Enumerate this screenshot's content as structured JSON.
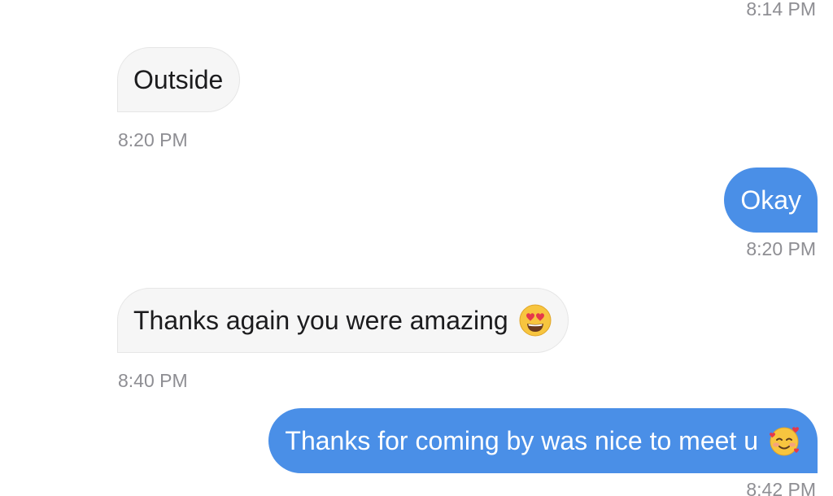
{
  "messages": [
    {
      "direction": "outgoing",
      "timestamp": "8:14 PM"
    },
    {
      "direction": "incoming",
      "text": "Outside",
      "timestamp": "8:20 PM"
    },
    {
      "direction": "outgoing",
      "text": "Okay",
      "timestamp": "8:20 PM"
    },
    {
      "direction": "incoming",
      "text": "Thanks again you were amazing",
      "emoji": "heart-eyes-emoji",
      "timestamp": "8:40 PM"
    },
    {
      "direction": "outgoing",
      "text": "Thanks for coming by was nice to meet u",
      "emoji": "smiling-face-with-hearts-emoji",
      "timestamp": "8:42 PM"
    }
  ],
  "colors": {
    "outgoing_bubble": "#4a8fe7",
    "incoming_bubble": "#f6f6f6",
    "timestamp": "#8e8e93",
    "incoming_text": "#1c1c1e"
  }
}
